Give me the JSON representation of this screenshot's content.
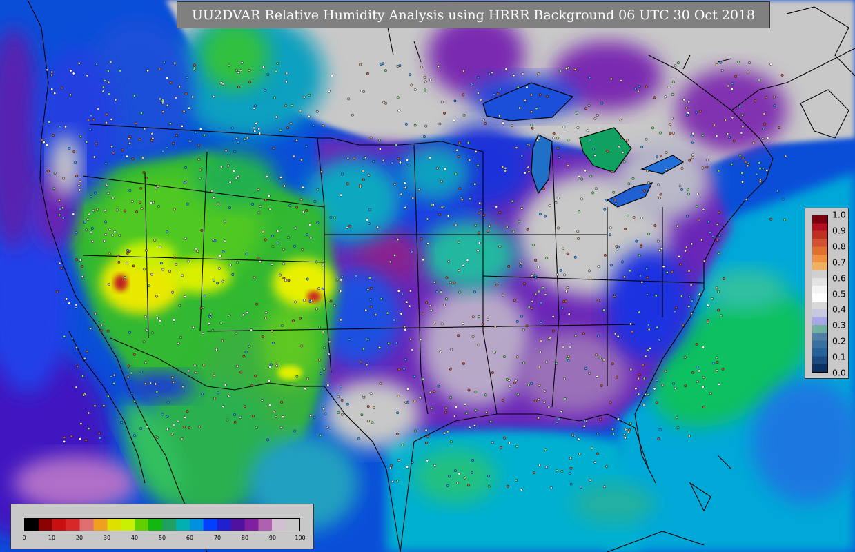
{
  "title": "UU2DVAR Relative Humidity Analysis using HRRR Background 06 UTC 30 Oct 2018",
  "rh_colorbar": {
    "ticks": [
      "0",
      "10",
      "20",
      "30",
      "40",
      "50",
      "60",
      "70",
      "80",
      "90",
      "100"
    ],
    "colors": [
      "#000000",
      "#8b0000",
      "#c81010",
      "#d82828",
      "#e07070",
      "#f0a020",
      "#e0e000",
      "#c8f000",
      "#60d000",
      "#10b810",
      "#20a060",
      "#00b0b0",
      "#0090e0",
      "#0040ff",
      "#2020d0",
      "#5010a0",
      "#8020a0",
      "#b060b0",
      "#d0c0d0",
      "#c8c8c8"
    ]
  },
  "increment_colorbar": {
    "ticks": [
      "1.0",
      "0.9",
      "0.8",
      "0.7",
      "0.6",
      "0.5",
      "0.4",
      "0.3",
      "0.2",
      "0.1",
      "0.0"
    ],
    "colors": [
      "#7a0010",
      "#b01020",
      "#c03020",
      "#d05030",
      "#e07030",
      "#f09040",
      "#f0b060",
      "#d0d0d0",
      "#e4e4e4",
      "#f4f4f4",
      "#ffffff",
      "#d8d8d8",
      "#c8c8e0",
      "#a8a8e8",
      "#70b0a0",
      "#5080a8",
      "#3870a0",
      "#28609a",
      "#1a4a80",
      "#0c3060"
    ]
  },
  "colors": {
    "land_gray": "#c8c8c8",
    "ocean_blue": "#0090e0",
    "ocean_cyan": "#00c0c0",
    "dry_yellow": "#e8e800",
    "green": "#30c030",
    "moist_blue": "#1030e0",
    "purple": "#7a1aa0",
    "border": "#000000"
  }
}
